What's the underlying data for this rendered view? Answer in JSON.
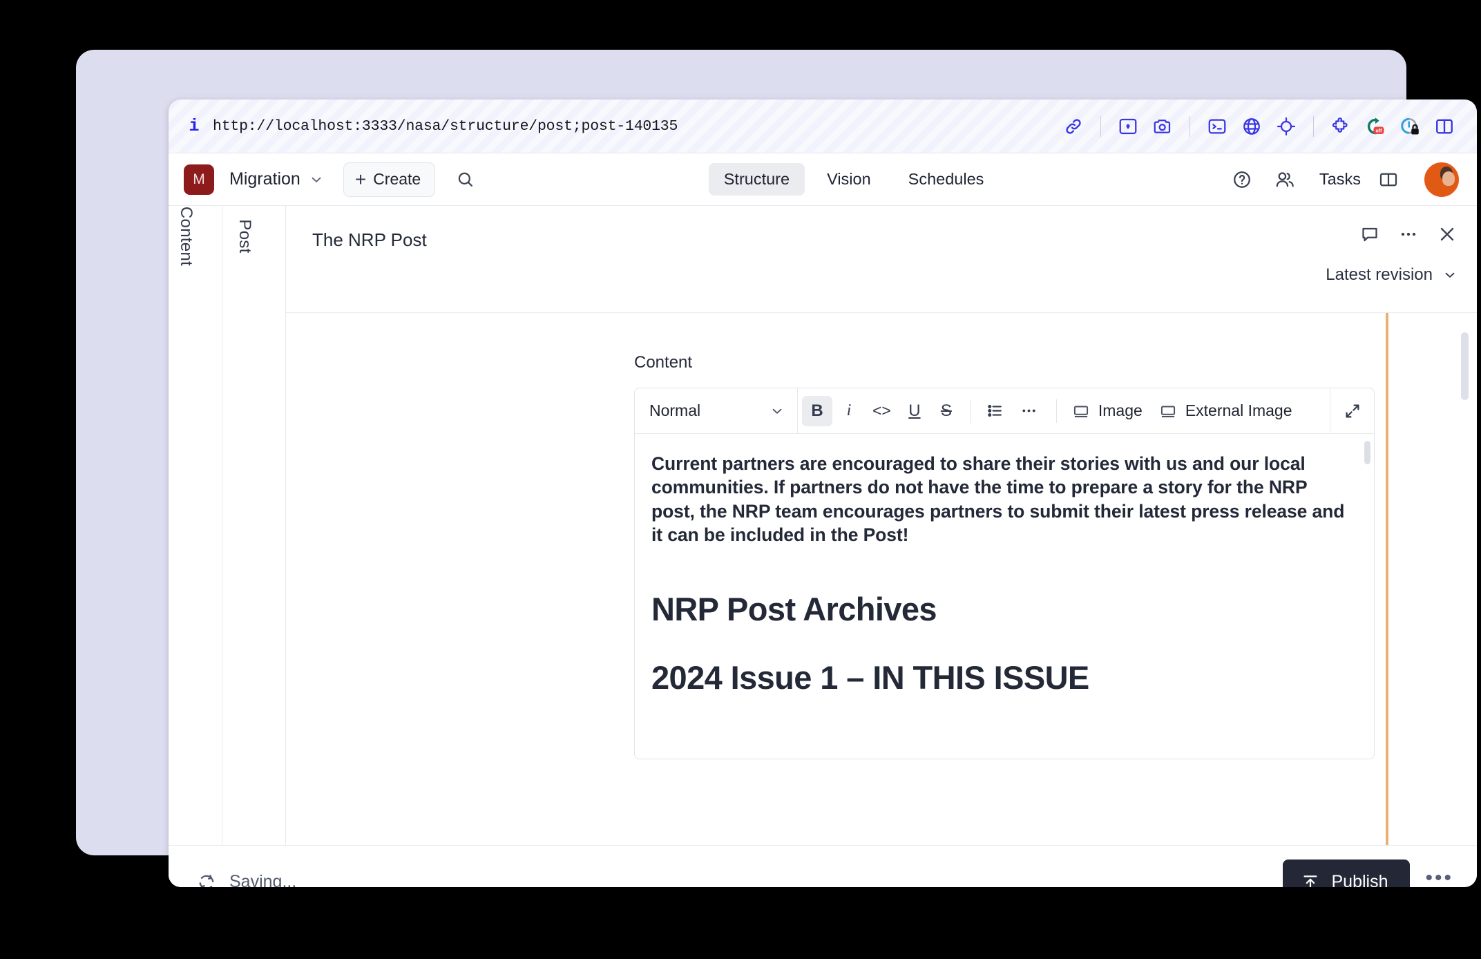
{
  "browser": {
    "info_icon": "info-icon",
    "url": "http://localhost:3333/nasa/structure/post;post-140135",
    "toolbar_icons": [
      {
        "name": "link-icon",
        "label": "Link"
      },
      {
        "name": "image-capture-icon",
        "label": "Capture Image"
      },
      {
        "name": "camera-icon",
        "label": "Screenshot"
      },
      {
        "name": "terminal-icon",
        "label": "Terminal"
      },
      {
        "name": "globe-icon",
        "label": "Network"
      },
      {
        "name": "target-icon",
        "label": "Inspect"
      },
      {
        "name": "puzzle-icon",
        "label": "Extensions"
      },
      {
        "name": "recorder-off-icon",
        "label": "off"
      },
      {
        "name": "privacy-lock-icon",
        "label": "Privacy"
      },
      {
        "name": "split-pane-icon",
        "label": "Split Pane"
      }
    ]
  },
  "header": {
    "logo_letter": "M",
    "project_name": "Migration",
    "create_label": "Create",
    "create_plus": "+",
    "tabs": [
      {
        "label": "Structure",
        "active": true
      },
      {
        "label": "Vision",
        "active": false
      },
      {
        "label": "Schedules",
        "active": false
      }
    ],
    "help_icon": "help-circle-icon",
    "users_icon": "users-icon",
    "tasks_label": "Tasks",
    "tasks_panel_icon": "panel-icon",
    "avatar_name": "user-avatar"
  },
  "rails": {
    "content_label": "Content",
    "post_label": "Post"
  },
  "document": {
    "title": "The NRP Post",
    "comment_icon": "comment-icon",
    "more_icon": "more-options-icon",
    "close_icon": "close-icon",
    "revision_label": "Latest revision"
  },
  "editor": {
    "field_label": "Content",
    "style_value": "Normal",
    "format_buttons": [
      {
        "name": "bold-button",
        "glyph": "B",
        "active": true
      },
      {
        "name": "italic-button",
        "glyph": "i",
        "active": false
      },
      {
        "name": "code-button",
        "glyph": "<>",
        "active": false
      },
      {
        "name": "underline-button",
        "glyph": "U",
        "active": false
      },
      {
        "name": "strikethrough-button",
        "glyph": "S",
        "active": false
      }
    ],
    "list_button": "bullet-list-button",
    "overflow_button": "more-formats-button",
    "image_label": "Image",
    "external_image_label": "External Image",
    "expand_label": "expand-editor-button",
    "content": {
      "paragraph": "Current partners are encouraged to share their stories with us and our local communities. If partners do not have the time to prepare a story for the NRP post, the NRP team encourages partners to submit their latest press release and it can be included in the Post!",
      "heading_1": "NRP Post Archives",
      "heading_2": "2024 Issue 1 – IN THIS ISSUE"
    }
  },
  "footer": {
    "status_icon": "sync-icon",
    "status_text": "Saving...",
    "publish_label": "Publish",
    "publish_icon": "publish-upload-icon",
    "more_label": "•••"
  },
  "colors": {
    "brand_logo": "#8e1b1b",
    "publish_bg": "#232736",
    "browser_icon": "#3a36e0",
    "change_indicator": "#e9b074",
    "window_border": "#ddddf0"
  }
}
